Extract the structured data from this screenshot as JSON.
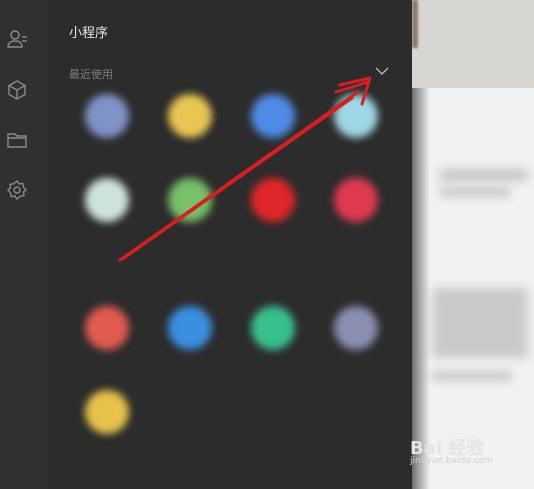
{
  "rail": {
    "icons": [
      "contacts-icon",
      "cube-icon",
      "folder-icon",
      "gear-icon"
    ]
  },
  "panel": {
    "title": "小程序",
    "section_label": "最近使用",
    "section2_label": "",
    "apps": [
      {
        "label": "",
        "color": "#7f93c6"
      },
      {
        "label": "",
        "color": "#e9c552"
      },
      {
        "label": "",
        "color": "#4f8ae6"
      },
      {
        "label": "",
        "color": "#9fd7e6"
      },
      {
        "label": "",
        "color": "#cfe3de"
      },
      {
        "label": "",
        "color": "#78c06a"
      },
      {
        "label": "",
        "color": "#e0262a"
      },
      {
        "label": "",
        "color": "#e03a52"
      },
      {
        "label": "",
        "color": "#e15a4f"
      },
      {
        "label": "",
        "color": "#3a8fe0"
      },
      {
        "label": "",
        "color": "#37c08e"
      },
      {
        "label": "",
        "color": "#8a8fb0"
      },
      {
        "label": "",
        "color": "#e6c24a"
      }
    ]
  },
  "watermark": {
    "text": "Bai 经验",
    "sub": "jingyan.baidu.com"
  },
  "colors": {
    "arrow": "#d81e1e",
    "panel_bg": "#2c2c2c",
    "rail_bg": "#2f3032"
  }
}
